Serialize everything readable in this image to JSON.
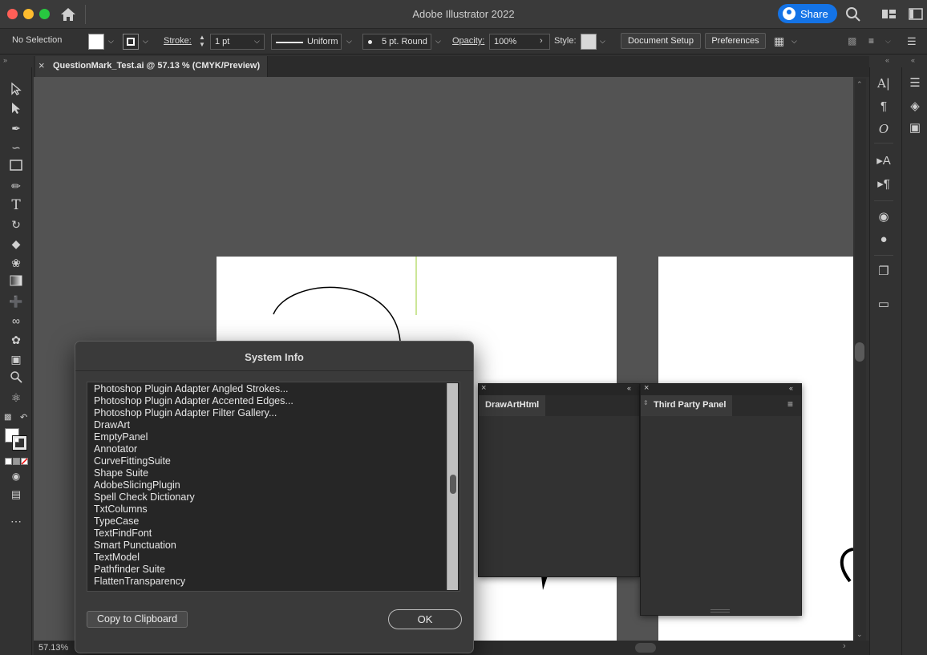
{
  "app": {
    "title": "Adobe Illustrator 2022",
    "share_label": "Share"
  },
  "control_bar": {
    "selection": "No Selection",
    "stroke_label": "Stroke:",
    "stroke_weight": "1 pt",
    "profile": "Uniform",
    "brush": "5 pt. Round",
    "opacity_label": "Opacity:",
    "opacity_value": "100%",
    "style_label": "Style:",
    "document_setup": "Document Setup",
    "preferences": "Preferences"
  },
  "document": {
    "tab_title": "QuestionMark_Test.ai @ 57.13 % (CMYK/Preview)"
  },
  "status": {
    "zoom": "57.13%"
  },
  "panels": {
    "drawart": {
      "tab": "DrawArtHtml"
    },
    "third_party": {
      "tab": "Third Party Panel"
    }
  },
  "dialog": {
    "title": "System Info",
    "items": [
      "Photoshop Plugin Adapter Angled Strokes...",
      "Photoshop Plugin Adapter Accented Edges...",
      "Photoshop Plugin Adapter Filter Gallery...",
      "DrawArt",
      "EmptyPanel",
      "Annotator",
      "CurveFittingSuite",
      "Shape Suite",
      "AdobeSlicingPlugin",
      "Spell Check Dictionary",
      "TxtColumns",
      "TypeCase",
      "TextFindFont",
      "Smart Punctuation",
      "TextModel",
      "Pathfinder Suite",
      "FlattenTransparency"
    ],
    "copy_label": "Copy to Clipboard",
    "ok_label": "OK"
  },
  "colors": {
    "accent": "#1473e6",
    "ui_dark": "#323232",
    "canvas": "#535353",
    "artboard": "#ffffff",
    "guide": "#9acd32"
  },
  "icons": [
    "home-icon",
    "search-icon",
    "workspace-icon",
    "arrange-icon",
    "close-icon",
    "selection-tool-icon",
    "direct-selection-tool-icon",
    "pen-tool-icon",
    "curvature-tool-icon",
    "rectangle-tool-icon",
    "paintbrush-tool-icon",
    "type-tool-icon",
    "rotate-tool-icon",
    "eraser-tool-icon",
    "lasso-tool-icon",
    "gradient-tool-icon",
    "eyedropper-tool-icon",
    "blend-tool-icon",
    "symbol-sprayer-icon",
    "artboard-tool-icon",
    "zoom-tool-icon",
    "puppet-warp-icon",
    "more-tools-icon",
    "properties-icon",
    "layers-icon",
    "libraries-icon",
    "character-icon",
    "paragraph-icon",
    "opentype-icon",
    "char-styles-icon",
    "para-styles-icon",
    "appearance-icon",
    "graphic-styles-icon",
    "transparency-icon",
    "comments-icon",
    "hamburger-menu-icon"
  ]
}
